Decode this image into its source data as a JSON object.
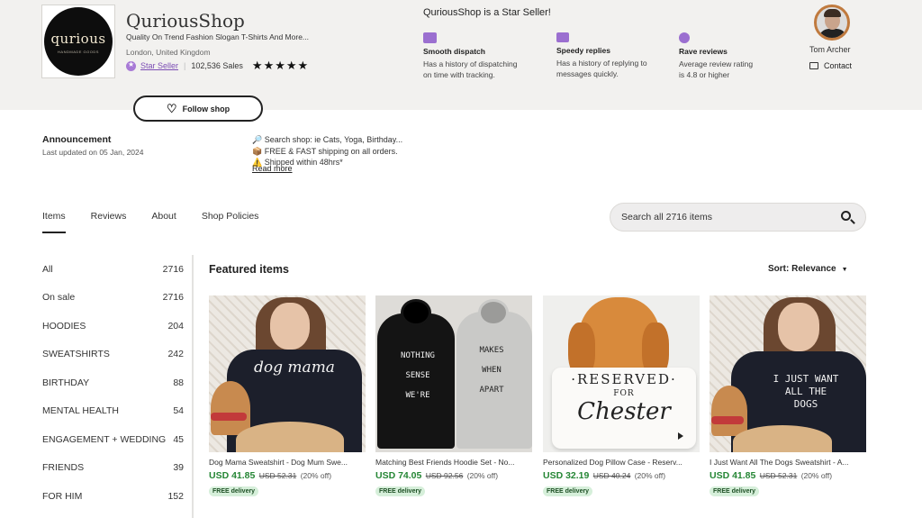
{
  "shop": {
    "logo_text": "qurious",
    "logo_subtext": "HANDMADE GOODS",
    "name": "QuriousShop",
    "tagline": "Quality On Trend Fashion Slogan T-Shirts And More...",
    "location": "London, United Kingdom",
    "star_seller_label": "Star Seller",
    "separator": "|",
    "sales": "102,536 Sales",
    "rating_stars": "★★★★★",
    "rating": 5
  },
  "star_seller": {
    "title": "QuriousShop is a Star Seller!",
    "perks": [
      {
        "icon": "truck-icon",
        "title": "Smooth dispatch",
        "desc_line1": "Has a history of dispatching",
        "desc_line2": "on time with tracking."
      },
      {
        "icon": "message-icon",
        "title": "Speedy replies",
        "desc_line1": "Has a history of replying to",
        "desc_line2": "messages quickly."
      },
      {
        "icon": "star-badge-icon",
        "title": "Rave reviews",
        "desc_line1": "Average review rating",
        "desc_line2": "is 4.8 or higher"
      }
    ]
  },
  "owner": {
    "name": "Tom Archer",
    "contact_label": "Contact"
  },
  "follow": {
    "label": "Follow shop"
  },
  "announcement": {
    "title": "Announcement",
    "updated": "Last updated on 05 Jan, 2024",
    "line1": "🔎 Search shop: ie Cats, Yoga, Birthday...",
    "line2": "📦 FREE & FAST shipping on all orders.",
    "line3": "⚠️ Shipped within 48hrs*",
    "read_more": "Read more"
  },
  "tabs": [
    {
      "label": "Items",
      "active": true
    },
    {
      "label": "Reviews",
      "active": false
    },
    {
      "label": "About",
      "active": false
    },
    {
      "label": "Shop Policies",
      "active": false
    }
  ],
  "search": {
    "placeholder": "Search all 2716 items"
  },
  "categories": [
    {
      "label": "All",
      "count": "2716"
    },
    {
      "label": "On sale",
      "count": "2716"
    },
    {
      "label": "HOODIES",
      "count": "204"
    },
    {
      "label": "SWEATSHIRTS",
      "count": "242"
    },
    {
      "label": "BIRTHDAY",
      "count": "88"
    },
    {
      "label": "MENTAL HEALTH",
      "count": "54"
    },
    {
      "label": "ENGAGEMENT + WEDDING",
      "count": "45"
    },
    {
      "label": "FRIENDS",
      "count": "39"
    },
    {
      "label": "FOR HIM",
      "count": "152"
    }
  ],
  "featured": {
    "title": "Featured items",
    "sort_label": "Sort: Relevance",
    "items": [
      {
        "title": "Dog Mama Sweatshirt - Dog Mum Swe...",
        "price": "USD 41.85",
        "original": "USD 52.31",
        "discount": "(20% off)",
        "badge": "FREE delivery",
        "print": "dog mama"
      },
      {
        "title": "Matching Best Friends Hoodie Set - No...",
        "price": "USD 74.05",
        "original": "USD 92.56",
        "discount": "(20% off)",
        "badge": "FREE delivery",
        "print_left": "NOTHING SENSE WE'RE",
        "print_right": "MAKES WHEN APART"
      },
      {
        "title": "Personalized Dog Pillow Case - Reserv...",
        "price": "USD 32.19",
        "original": "USD 40.24",
        "discount": "(20% off)",
        "badge": "FREE delivery",
        "print_top": "·RESERVED·",
        "print_mid": "FOR",
        "print_name": "Chester"
      },
      {
        "title": "I Just Want All The Dogs Sweatshirt - A...",
        "price": "USD 41.85",
        "original": "USD 52.31",
        "discount": "(20% off)",
        "badge": "FREE delivery",
        "print_line1": "I JUST WANT",
        "print_line2": "ALL THE",
        "print_line3": "DOGS"
      }
    ]
  },
  "colors": {
    "header_bg": "#f2f1ef",
    "star_purple": "#7b4cb4",
    "price_green": "#258635",
    "badge_bg": "#d6efda"
  }
}
